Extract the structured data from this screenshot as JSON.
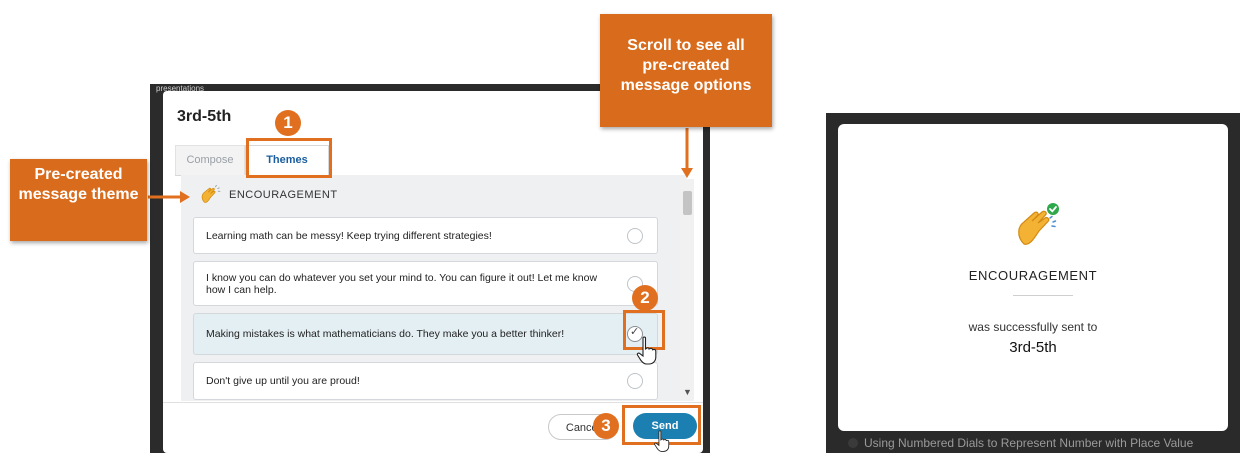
{
  "modal": {
    "frame_label": "presentations",
    "title": "3rd-5th",
    "tabs": [
      {
        "label": "Compose"
      },
      {
        "label": "Themes"
      }
    ],
    "theme_header": "ENCOURAGEMENT",
    "messages": [
      {
        "text": "Learning math can be messy! Keep trying different strategies!",
        "selected": false
      },
      {
        "text": "I know you can do whatever you set your mind to. You can figure it out! Let me know how I can help.",
        "selected": false
      },
      {
        "text": "Making mistakes is what mathematicians do. They make you a better thinker!",
        "selected": true
      },
      {
        "text": "Don't give up until you are proud!",
        "selected": false
      }
    ],
    "cancel_label": "Cancel",
    "send_label": "Send"
  },
  "annotations": {
    "precreated_theme": "Pre-created message theme",
    "scroll_hint": "Scroll to see all pre-created message options",
    "badges": [
      "1",
      "2",
      "3"
    ]
  },
  "success": {
    "theme": "ENCOURAGEMENT",
    "message": "was successfully sent to",
    "target": "3rd-5th",
    "caption": "Using Numbered Dials to Represent Number with Place Value"
  },
  "colors": {
    "accent_orange": "#e0701f",
    "send_blue": "#1b7fb1",
    "tab_active": "#1a5e9f"
  }
}
